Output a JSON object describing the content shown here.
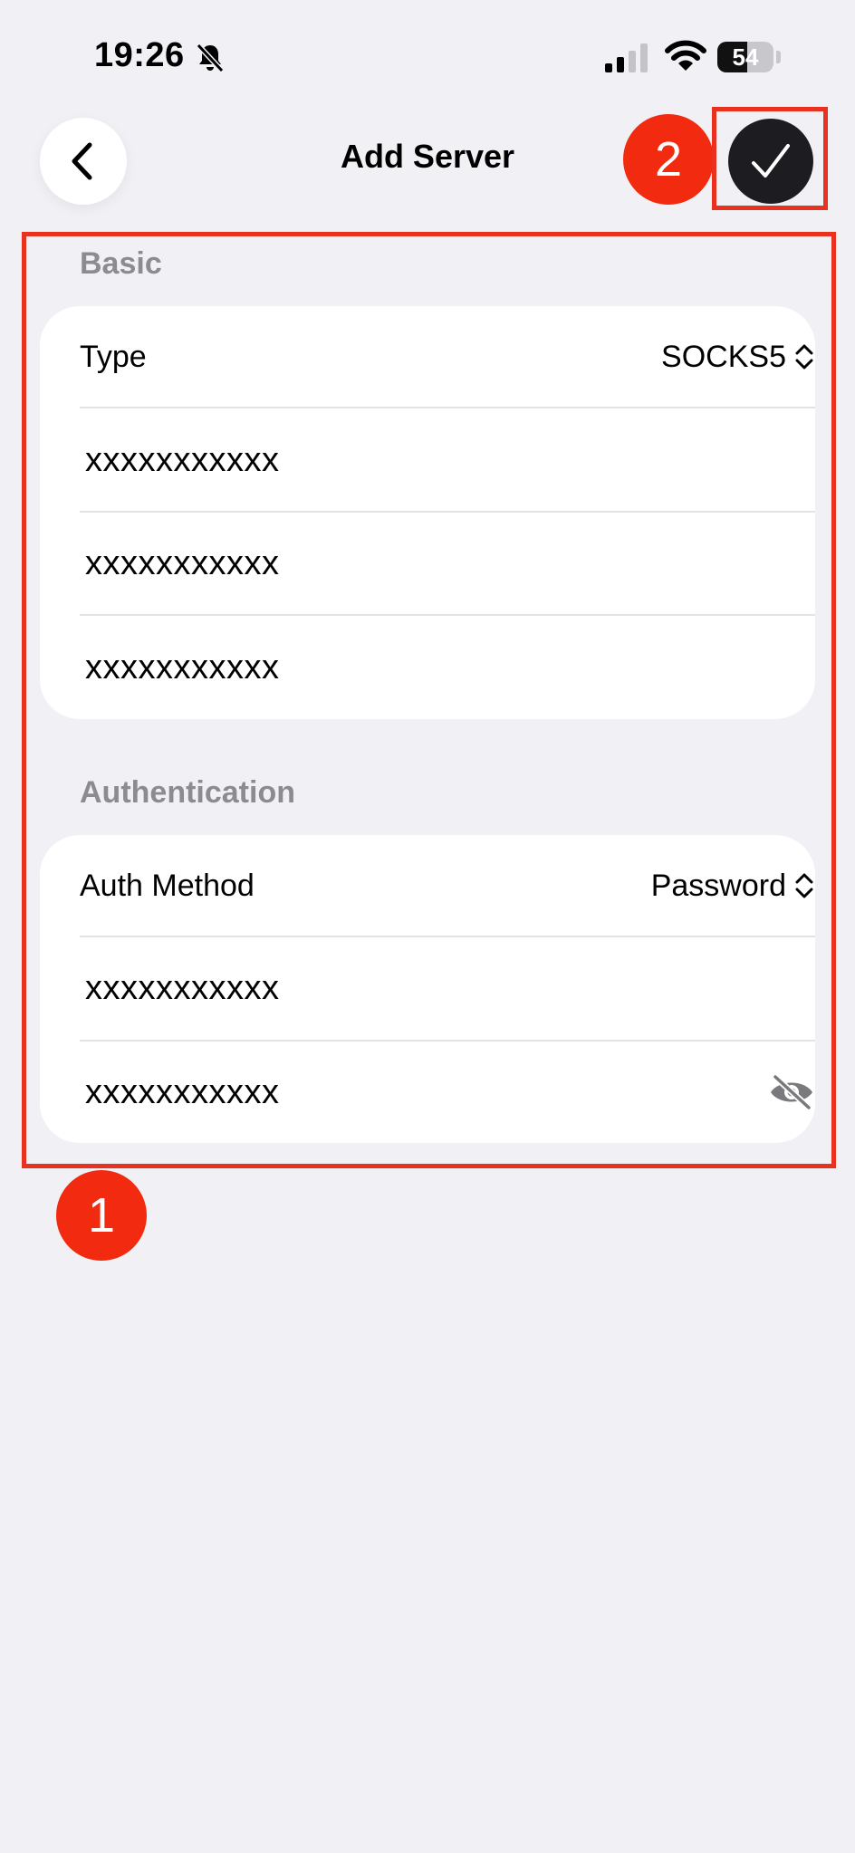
{
  "status_bar": {
    "time": "19:26",
    "battery": "54",
    "battery_level": 0.54
  },
  "nav": {
    "title": "Add Server"
  },
  "annotations": {
    "badge_1": "1",
    "badge_2": "2",
    "highlight_color": "#e8321f",
    "badge_color": "#f22a0f"
  },
  "sections": {
    "basic": {
      "header": "Basic",
      "type_label": "Type",
      "type_value": "SOCKS5",
      "fields": [
        "xxxxxxxxxxx",
        "xxxxxxxxxxx",
        "xxxxxxxxxxx"
      ]
    },
    "auth": {
      "header": "Authentication",
      "method_label": "Auth Method",
      "method_value": "Password",
      "username": "xxxxxxxxxxx",
      "password": "xxxxxxxxxxx"
    }
  },
  "icons": {
    "back": "chevron-left-icon",
    "done": "checkmark-icon",
    "picker": "chevron-up-down-icon",
    "password_toggle": "eye-slash-icon",
    "bell": "bell-slash-icon"
  }
}
